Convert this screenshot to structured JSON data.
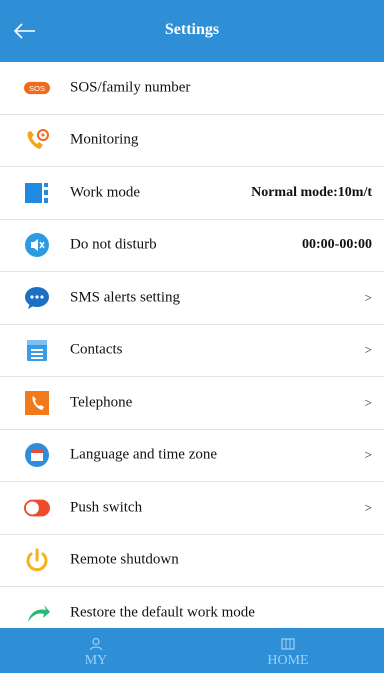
{
  "header": {
    "title": "Settings",
    "back_icon": "arrow-left-icon"
  },
  "settings": [
    {
      "key": "sos",
      "label": "SOS/family number",
      "icon": "sos-icon",
      "value": "",
      "chevron": ""
    },
    {
      "key": "monitoring",
      "label": "Monitoring",
      "icon": "phone-monitor-icon",
      "value": "",
      "chevron": ""
    },
    {
      "key": "work_mode",
      "label": "Work mode",
      "icon": "work-mode-icon",
      "value": "Normal mode:10m/t",
      "chevron": ""
    },
    {
      "key": "dnd",
      "label": "Do not disturb",
      "icon": "mute-icon",
      "value": "00:00-00:00",
      "chevron": ""
    },
    {
      "key": "sms",
      "label": "SMS alerts setting",
      "icon": "chat-bubble-icon",
      "value": "",
      "chevron": ">"
    },
    {
      "key": "contacts",
      "label": "Contacts",
      "icon": "contacts-book-icon",
      "value": "",
      "chevron": ">"
    },
    {
      "key": "telephone",
      "label": "Telephone",
      "icon": "telephone-icon",
      "value": "",
      "chevron": ">"
    },
    {
      "key": "language",
      "label": "Language and time zone",
      "icon": "calendar-icon",
      "value": "",
      "chevron": ">"
    },
    {
      "key": "push",
      "label": "Push switch",
      "icon": "toggle-icon",
      "value": "",
      "chevron": ">"
    },
    {
      "key": "shutdown",
      "label": "Remote shutdown",
      "icon": "power-icon",
      "value": "",
      "chevron": ""
    },
    {
      "key": "restore",
      "label": "Restore the default work mode",
      "icon": "restore-arrow-icon",
      "value": "",
      "chevron": ""
    }
  ],
  "tabs": [
    {
      "label": "MY",
      "icon": "user-icon"
    },
    {
      "label": "HOME",
      "icon": "map-icon"
    }
  ],
  "colors": {
    "accent": "#2e8ed6",
    "tab_text": "#9fd0f5"
  }
}
